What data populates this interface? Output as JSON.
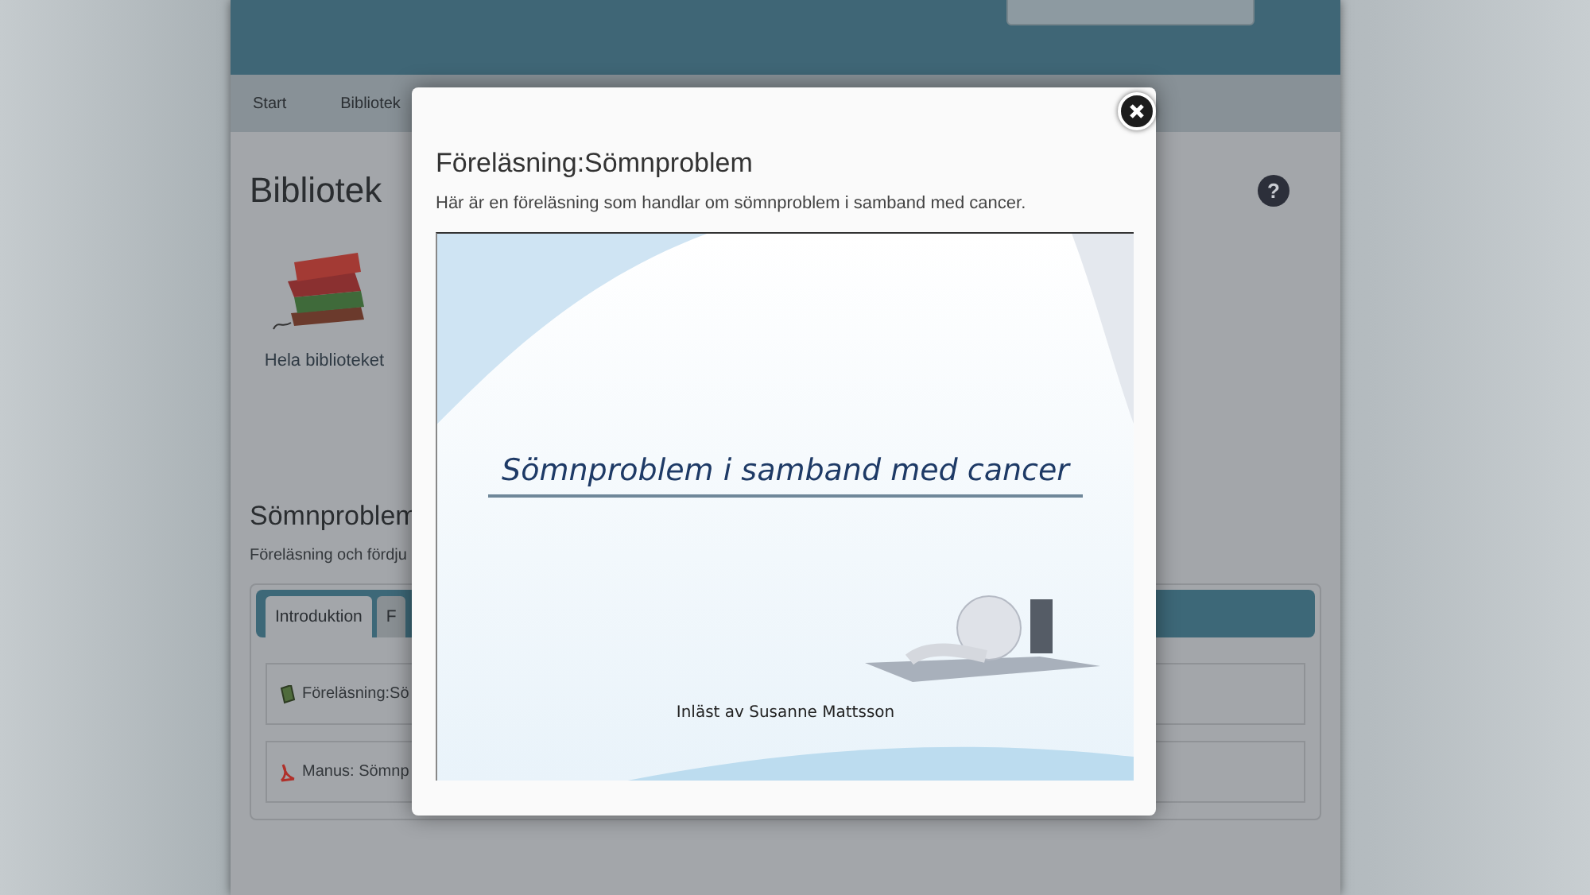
{
  "page": {
    "nav": [
      {
        "label": "Start"
      },
      {
        "label": "Bibliotek"
      }
    ],
    "heading": "Bibliotek",
    "help": "?",
    "library_item": {
      "label": "Hela biblioteket"
    },
    "section_title": "Sömnproblem",
    "section_intro": "Föreläsning och fördju",
    "tabs": [
      {
        "label": "Introduktion",
        "selected": true
      },
      {
        "label": "F",
        "selected": false
      }
    ],
    "items": [
      {
        "kind": "lecture",
        "label": "Föreläsning:Sö"
      },
      {
        "kind": "pdf",
        "label": "Manus: Sömnp"
      }
    ]
  },
  "modal": {
    "title": "Föreläsning:Sömnproblem",
    "description": "Här är en föreläsning som handlar om sömnproblem i samband med cancer.",
    "slide": {
      "title": "Sömnproblem i samband med cancer",
      "credit": "Inläst av Susanne Mattsson"
    }
  }
}
